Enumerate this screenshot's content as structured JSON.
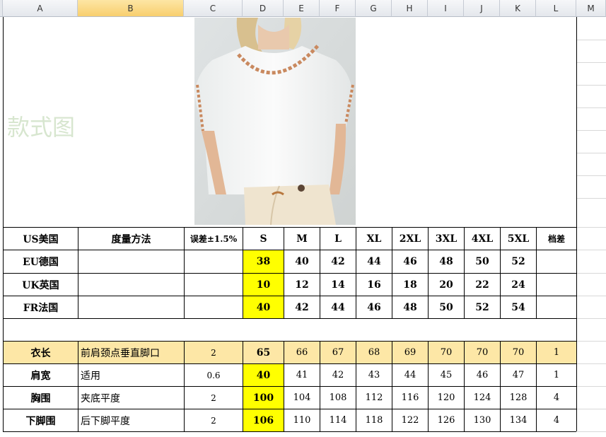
{
  "column_headers": [
    "A",
    "B",
    "C",
    "D",
    "E",
    "F",
    "G",
    "H",
    "I",
    "J",
    "K",
    "L",
    "M"
  ],
  "selected_column": "B",
  "style_image_label": "款式图",
  "size_header": {
    "region": "US美国",
    "method": "度量方法",
    "tolerance": "误差±1.5%",
    "sizes": [
      "S",
      "M",
      "L",
      "XL",
      "2XL",
      "3XL",
      "4XL",
      "5XL"
    ],
    "grade": "档差"
  },
  "size_rows": [
    {
      "region": "EU德国",
      "values": [
        "38",
        "40",
        "42",
        "44",
        "46",
        "48",
        "50",
        "52"
      ]
    },
    {
      "region": "UK英国",
      "values": [
        "10",
        "12",
        "14",
        "16",
        "18",
        "20",
        "22",
        "24"
      ]
    },
    {
      "region": "FR法国",
      "values": [
        "40",
        "42",
        "44",
        "46",
        "48",
        "50",
        "52",
        "54"
      ]
    }
  ],
  "measure_rows": [
    {
      "name": "衣长",
      "method": "前肩颈点垂直脚口",
      "tolerance": "2",
      "values": [
        "65",
        "66",
        "67",
        "68",
        "69",
        "70",
        "70",
        "70"
      ],
      "grade": "1"
    },
    {
      "name": "肩宽",
      "method": "适用",
      "tolerance": "0.6",
      "values": [
        "40",
        "41",
        "42",
        "43",
        "44",
        "45",
        "46",
        "47"
      ],
      "grade": "1"
    },
    {
      "name": "胸围",
      "method": "夹底平度",
      "tolerance": "2",
      "values": [
        "100",
        "104",
        "108",
        "112",
        "116",
        "120",
        "124",
        "128"
      ],
      "grade": "4"
    },
    {
      "name": "下脚围",
      "method": "后下脚平度",
      "tolerance": "2",
      "values": [
        "106",
        "110",
        "114",
        "118",
        "122",
        "126",
        "130",
        "134"
      ],
      "grade": "4"
    }
  ],
  "colors": {
    "highlight_yellow": "#ffff00",
    "row_orange": "#fde7a6",
    "selected_header": "#f8cf6e"
  }
}
